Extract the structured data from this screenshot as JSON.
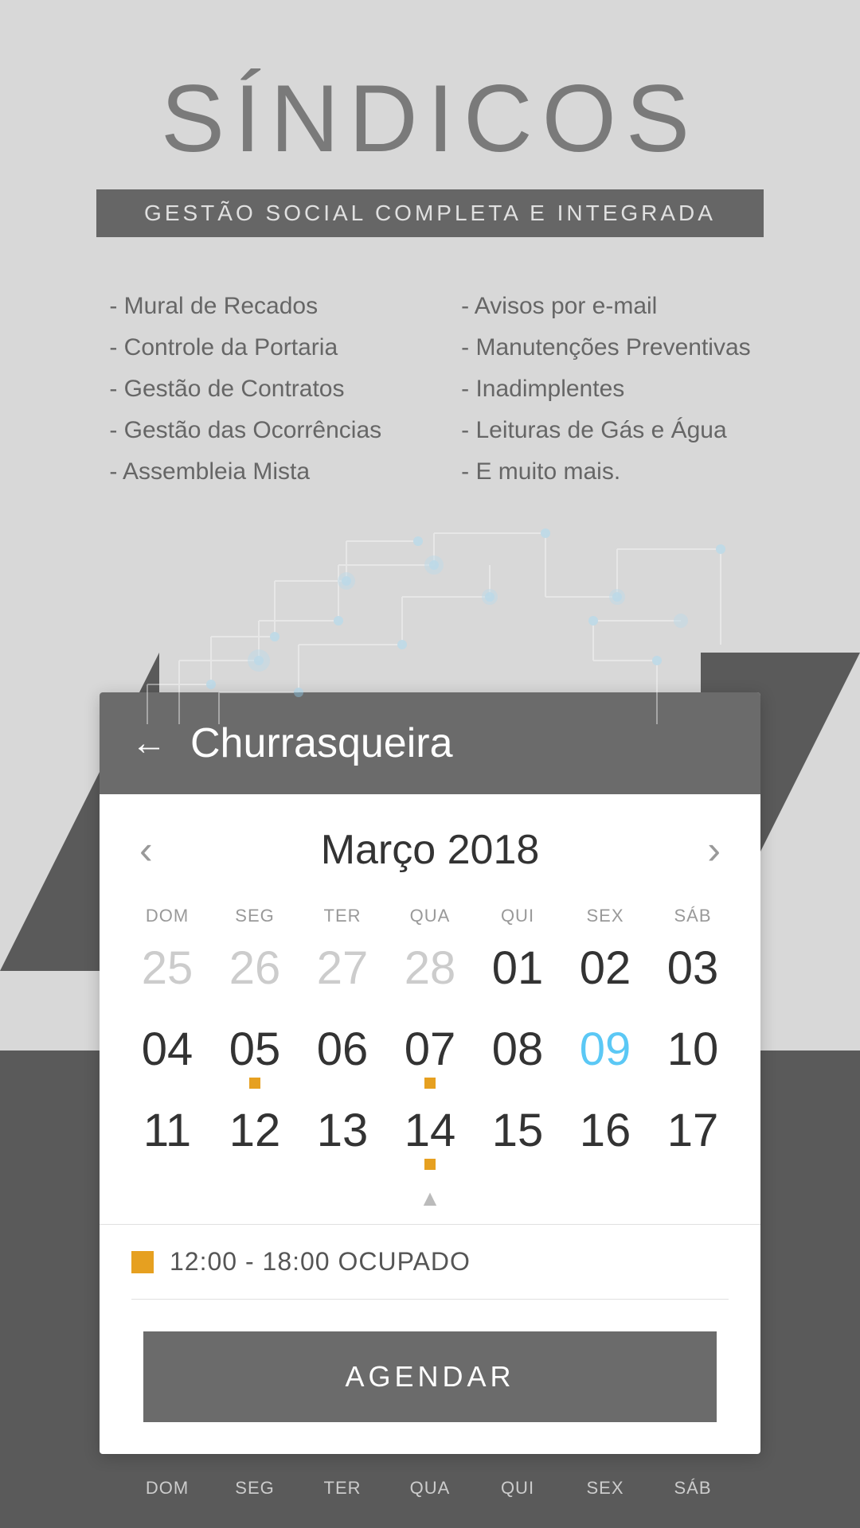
{
  "app": {
    "title": "SÍNDICOS",
    "subtitle": "GESTÃO SOCIAL COMPLETA E INTEGRADA"
  },
  "features": {
    "left": [
      "- Mural de Recados",
      "- Controle da Portaria",
      "- Gestão de Contratos",
      "- Gestão das Ocorrências",
      "- Assembleia Mista"
    ],
    "right": [
      "- Avisos por e-mail",
      "- Manutenções Preventivas",
      "- Inadimplentes",
      "- Leituras de Gás e Água",
      "- E muito mais."
    ]
  },
  "calendar": {
    "back_label": "←",
    "screen_title": "Churrasqueira",
    "month": "Março 2018",
    "prev_arrow": "‹",
    "next_arrow": "›",
    "day_headers": [
      "DOM",
      "SEG",
      "TER",
      "QUA",
      "QUI",
      "SEX",
      "SÁB"
    ],
    "weeks": [
      [
        {
          "num": "25",
          "faded": true,
          "dot": false
        },
        {
          "num": "26",
          "faded": true,
          "dot": false
        },
        {
          "num": "27",
          "faded": true,
          "dot": false
        },
        {
          "num": "28",
          "faded": true,
          "dot": false
        },
        {
          "num": "01",
          "faded": false,
          "dot": false
        },
        {
          "num": "02",
          "faded": false,
          "dot": false
        },
        {
          "num": "03",
          "faded": false,
          "dot": false
        }
      ],
      [
        {
          "num": "04",
          "faded": false,
          "dot": false
        },
        {
          "num": "05",
          "faded": false,
          "dot": true
        },
        {
          "num": "06",
          "faded": false,
          "dot": false
        },
        {
          "num": "07",
          "faded": false,
          "dot": true
        },
        {
          "num": "08",
          "faded": false,
          "dot": false
        },
        {
          "num": "09",
          "faded": false,
          "dot": false,
          "highlight": true
        },
        {
          "num": "10",
          "faded": false,
          "dot": false
        }
      ],
      [
        {
          "num": "11",
          "faded": false,
          "dot": false
        },
        {
          "num": "12",
          "faded": false,
          "dot": false
        },
        {
          "num": "13",
          "faded": false,
          "dot": false
        },
        {
          "num": "14",
          "faded": false,
          "dot": true
        },
        {
          "num": "15",
          "faded": false,
          "dot": false
        },
        {
          "num": "16",
          "faded": false,
          "dot": false
        },
        {
          "num": "17",
          "faded": false,
          "dot": false
        }
      ]
    ],
    "occupied_text": "12:00 - 18:00 OCUPADO",
    "agendar_label": "AGENDAR",
    "bottom_headers": [
      "DOM",
      "SEG",
      "TER",
      "QUA",
      "QUI",
      "SEX",
      "SÁB"
    ]
  }
}
